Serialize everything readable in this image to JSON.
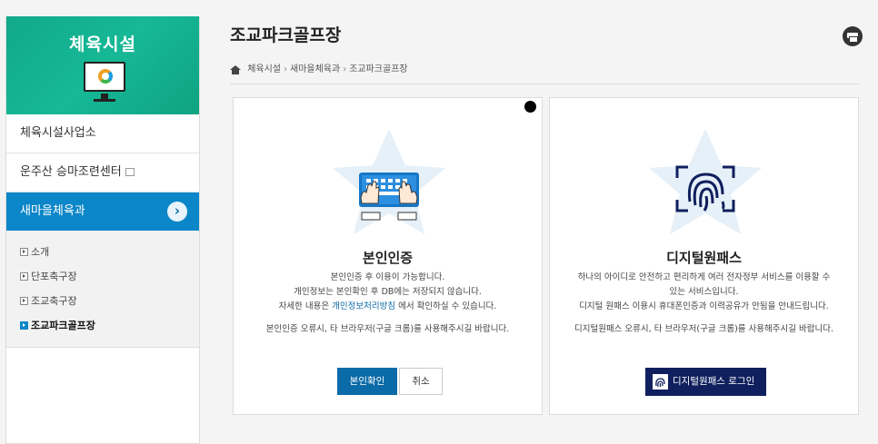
{
  "sidebar": {
    "title": "체육시설",
    "items": [
      {
        "label": "체육시설사업소"
      },
      {
        "label": "운주산 승마조련센터"
      }
    ],
    "active": {
      "label": "새마을체육과"
    },
    "sub_items": [
      {
        "label": "소개"
      },
      {
        "label": "단포축구장"
      },
      {
        "label": "조교축구장"
      },
      {
        "label": "조교파크골프장"
      }
    ]
  },
  "header": {
    "title": "조교파크골프장",
    "breadcrumb": [
      "체육시설",
      "새마을체육과",
      "조교파크골프장"
    ]
  },
  "cards": {
    "identity": {
      "title": "본인인증",
      "line1": "본인인증 후 이용이 가능합니다.",
      "line2": "개인정보는 본인확인 후 DB에는 저장되지 않습니다.",
      "line3_pre": "자세한 내용은 ",
      "line3_link": "개인정보처리방침",
      "line3_post": " 에서 확인하실 수 있습니다.",
      "note": "본인인증 오류시, 타 브라우저(구글 크롬)를 사용해주시길 바랍니다.",
      "confirm_label": "본인확인",
      "cancel_label": "취소"
    },
    "digital": {
      "title": "디지털원패스",
      "line1": "하나의 아이디로 안전하고 편리하게 여러 전자정부 서비스를 이용할 수",
      "line2": "있는 서비스입니다.",
      "line3": "디지털 원패스 이용시 휴대폰인증과 이력공유가 안됨을 안내드립니다.",
      "note": "디지털원패스 오류시, 타 브라우저(구글 크롬)를 사용해주시길 바랍니다.",
      "login_label": "디지털원패스 로그인"
    }
  },
  "colors": {
    "sidebar_header": "#16b896",
    "active_menu": "#0b86c8",
    "primary_button": "#0b6aa8",
    "onepass_button": "#10205e"
  },
  "icons": [
    "monitor-icon",
    "chevron-right-icon",
    "home-icon",
    "print-icon",
    "keyboard-hands-icon",
    "fingerprint-icon",
    "external-window-icon"
  ]
}
